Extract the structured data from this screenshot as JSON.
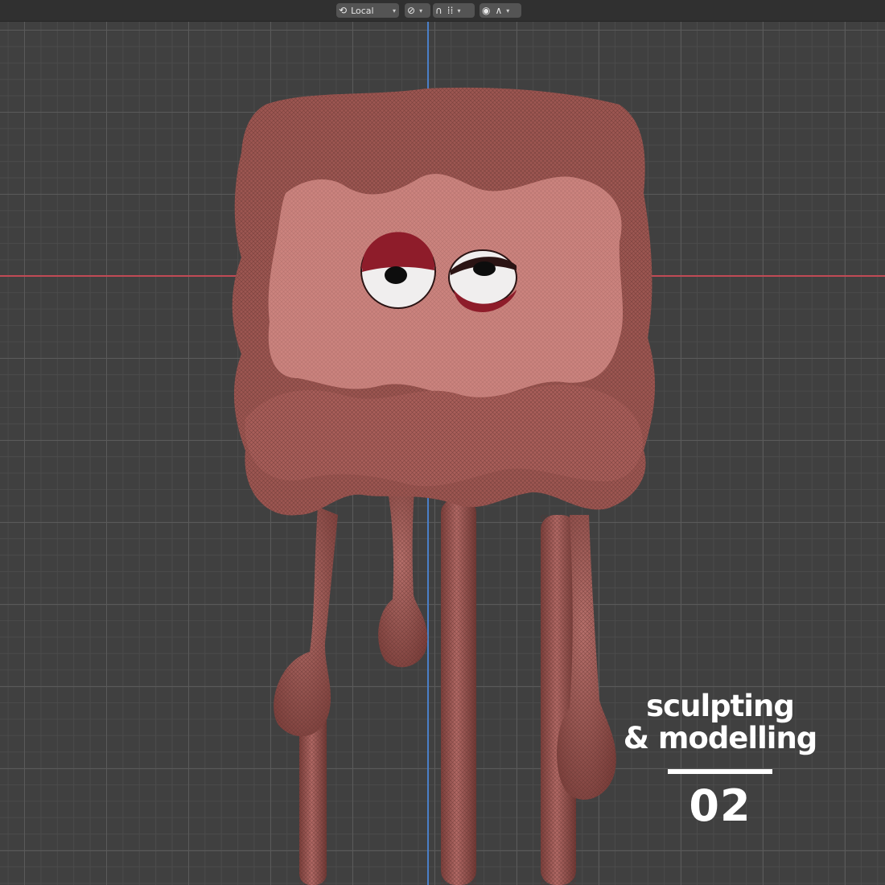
{
  "header": {
    "orientation": {
      "label": "Local",
      "icon": "transform-orientation-icon"
    },
    "pivot": {
      "icon": "pivot-point-icon"
    },
    "snap": {
      "icon": "snap-magnet-icon",
      "increment_icon": "snap-increment-icon"
    },
    "proportional": {
      "icon": "proportional-editing-icon",
      "falloff_icon": "falloff-curve-icon"
    }
  },
  "overlay": {
    "line1": "sculpting",
    "line2": "& modelling",
    "number": "02"
  },
  "colors": {
    "axis_x": "#c04a55",
    "axis_y": "#4a7fc8",
    "body": "#a15a55",
    "face": "#cd8580",
    "eyelid": "#8e1c2a"
  }
}
